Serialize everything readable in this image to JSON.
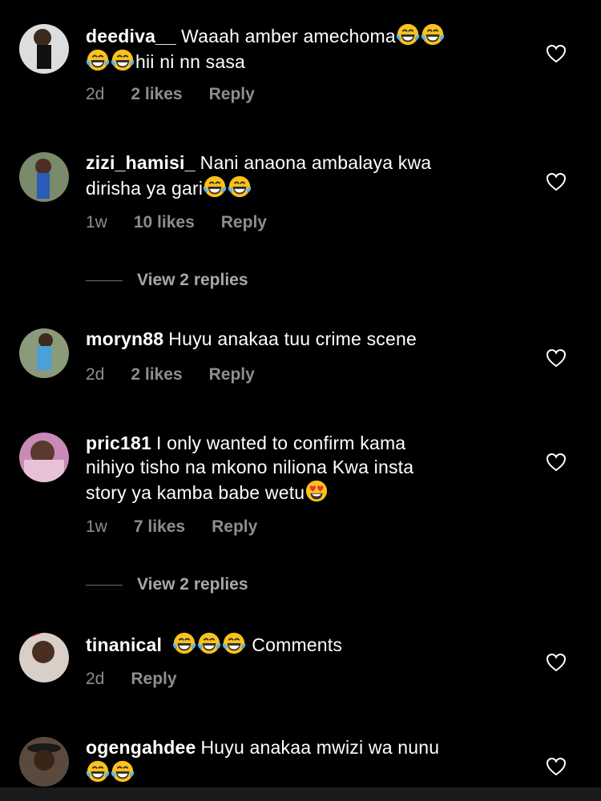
{
  "comments": [
    {
      "username": "deediva__",
      "text": "Waaah amber amechoma",
      "emoji_after_text": 2,
      "line2_emojis": 2,
      "line2_text": "hii ni nn sasa",
      "time": "2d",
      "likes": "2 likes",
      "reply": "Reply"
    },
    {
      "username": "zizi_hamisi_",
      "text": "Nani anaona ambalaya kwa",
      "line2_text": "dirisha ya gari",
      "line2_emojis_after": 2,
      "time": "1w",
      "likes": "10 likes",
      "reply": "Reply",
      "view_replies": "View 2 replies"
    },
    {
      "username": "moryn88",
      "text": "Huyu anakaa tuu crime scene",
      "time": "2d",
      "likes": "2 likes",
      "reply": "Reply"
    },
    {
      "username": "pric181",
      "text": "I only wanted to confirm kama",
      "line2_text": "nihiyo tisho na mkono niliona Kwa insta",
      "line3_text": "story ya kamba babe wetu",
      "time": "1w",
      "likes": "7 likes",
      "reply": "Reply",
      "view_replies": "View 2 replies"
    },
    {
      "username": "tinanical",
      "text": "Comments",
      "emoji_before_text": 3,
      "time": "2d",
      "reply": "Reply"
    },
    {
      "username": "ogengahdee",
      "text": "Huyu anakaa mwizi wa nunu",
      "line2_emojis": 2
    }
  ],
  "icons": {
    "laugh_emoji": "face-with-tears-of-joy",
    "heart_eyes_emoji": "smiling-face-with-heart-eyes",
    "like": "heart-outline"
  },
  "colors": {
    "background": "#000000",
    "text": "#ffffff",
    "meta": "#8e8e8e"
  }
}
